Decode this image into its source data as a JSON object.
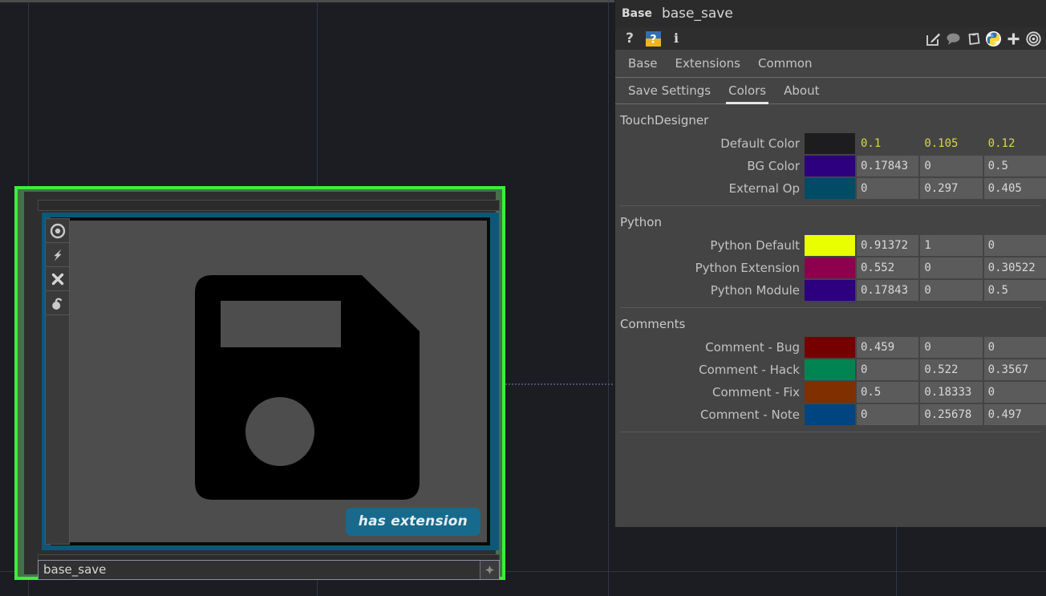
{
  "window": {
    "op_type_label": "Base",
    "op_name": "base_save"
  },
  "toolbar": {
    "left_icons": [
      {
        "name": "help-question-icon",
        "glyph": "?"
      },
      {
        "name": "op-snippets-icon",
        "glyph": "?"
      },
      {
        "name": "info-icon",
        "glyph": "i"
      }
    ],
    "right_icons": [
      {
        "name": "edit-pencil-icon"
      },
      {
        "name": "comment-bubble-icon"
      },
      {
        "name": "clipboard-paste-icon"
      },
      {
        "name": "python-logo-icon"
      },
      {
        "name": "add-plus-icon"
      },
      {
        "name": "target-bullseye-icon"
      }
    ]
  },
  "tabs": {
    "primary": [
      {
        "label": "Base",
        "active": false
      },
      {
        "label": "Extensions",
        "active": false
      },
      {
        "label": "Common",
        "active": false
      }
    ],
    "secondary": [
      {
        "label": "Save Settings",
        "active": false
      },
      {
        "label": "Colors",
        "active": true
      },
      {
        "label": "About",
        "active": false
      }
    ]
  },
  "sections": [
    {
      "title": "TouchDesigner",
      "rows": [
        {
          "label": "Default Color",
          "swatch": "#1d1d20",
          "is_default": true,
          "values": [
            "0.1",
            "0.105",
            "0.12"
          ]
        },
        {
          "label": "BG Color",
          "swatch": "#2d0080",
          "is_default": false,
          "values": [
            "0.17843",
            "0",
            "0.5"
          ]
        },
        {
          "label": "External Op",
          "swatch": "#004c67",
          "is_default": false,
          "values": [
            "0",
            "0.297",
            "0.405"
          ]
        }
      ]
    },
    {
      "title": "Python",
      "rows": [
        {
          "label": "Python Default",
          "swatch": "#e9ff00",
          "is_default": false,
          "values": [
            "0.91372",
            "1",
            "0"
          ]
        },
        {
          "label": "Python Extension",
          "swatch": "#8d004e",
          "is_default": false,
          "values": [
            "0.552",
            "0",
            "0.30522"
          ]
        },
        {
          "label": "Python Module",
          "swatch": "#2d0080",
          "is_default": false,
          "values": [
            "0.17843",
            "0",
            "0.5"
          ]
        }
      ]
    },
    {
      "title": "Comments",
      "rows": [
        {
          "label": "Comment - Bug",
          "swatch": "#750000",
          "is_default": false,
          "values": [
            "0.459",
            "0",
            "0"
          ]
        },
        {
          "label": "Comment - Hack",
          "swatch": "#008552",
          "is_default": false,
          "values": [
            "0",
            "0.522",
            "0.3567"
          ]
        },
        {
          "label": "Comment - Fix",
          "swatch": "#803000",
          "is_default": false,
          "values": [
            "0.5",
            "0.18333",
            "0"
          ]
        },
        {
          "label": "Comment - Note",
          "swatch": "#00457f",
          "is_default": false,
          "values": [
            "0",
            "0.25678",
            "0.497"
          ]
        }
      ]
    }
  ],
  "node": {
    "name": "base_save",
    "extension_badge": "has extension",
    "selection_color": "#39f03a",
    "frame_color": "#0d5878",
    "rail_icons": [
      {
        "name": "viewer-active-icon"
      },
      {
        "name": "cook-lightning-icon"
      },
      {
        "name": "bypass-x-icon"
      },
      {
        "name": "lock-icon"
      }
    ],
    "name_field_button": "expand-plus-icon",
    "thumbnail_icon": "floppy-disk-save-icon"
  }
}
